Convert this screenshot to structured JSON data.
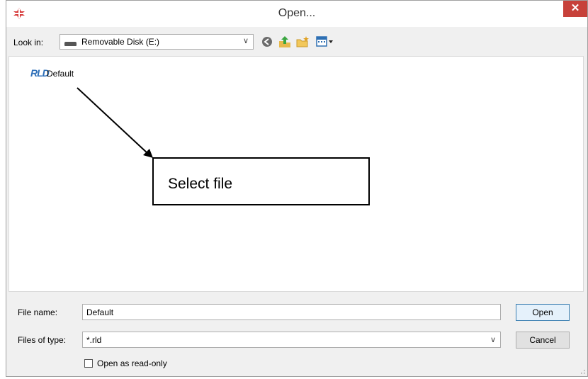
{
  "window": {
    "title": "Open...",
    "close_label": "✕"
  },
  "toolbar": {
    "lookin_label": "Look in:",
    "lookin_value": "Removable Disk (E:)",
    "icons": [
      "back-icon",
      "up-folder-icon",
      "new-folder-icon",
      "view-menu-icon"
    ]
  },
  "files": [
    {
      "icon_text": "RLD",
      "name": "Default"
    }
  ],
  "annotation": {
    "callout_text": "Select file"
  },
  "form": {
    "filename_label": "File name:",
    "filename_value": "Default",
    "filetype_label": "Files of type:",
    "filetype_value": "*.rld",
    "readonly_label": "Open as read-only",
    "readonly_checked": false
  },
  "buttons": {
    "open_label": "Open",
    "cancel_label": "Cancel"
  },
  "colors": {
    "close_button": "#c7413a",
    "rld_icon": "#2e6fb8",
    "app_icon": "#d63a3a"
  }
}
